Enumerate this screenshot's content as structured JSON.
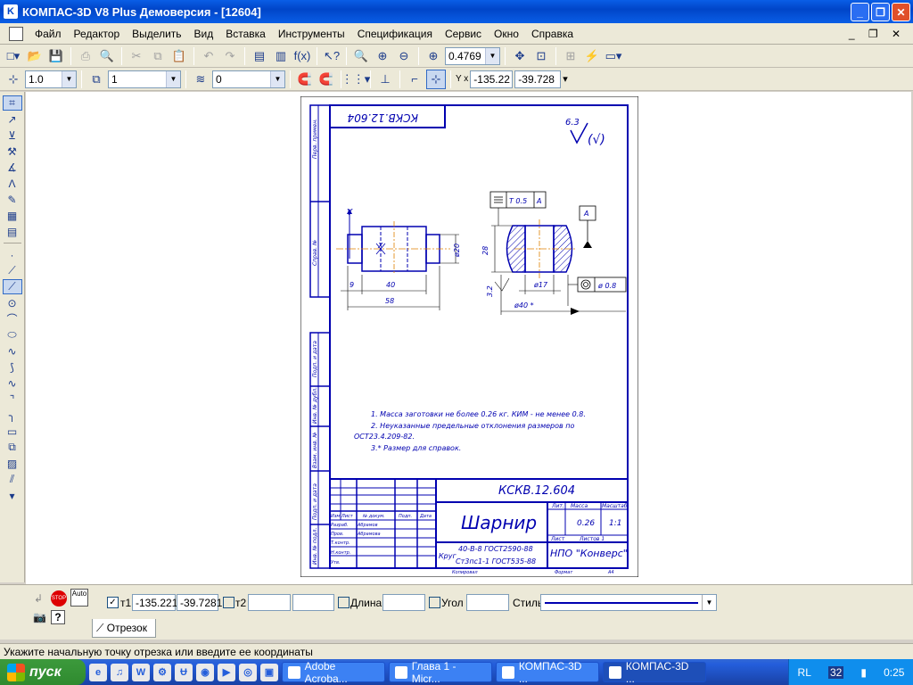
{
  "window": {
    "title": "КОМПАС-3D V8 Plus Демоверсия - [12604]"
  },
  "menu": [
    "Файл",
    "Редактор",
    "Выделить",
    "Вид",
    "Вставка",
    "Инструменты",
    "Спецификация",
    "Сервис",
    "Окно",
    "Справка"
  ],
  "toolbar1": {
    "zoom_value": "0.4769"
  },
  "toolbar2": {
    "step": "1.0",
    "layer": "1",
    "style_value": "0",
    "coord_x": "-135.22",
    "coord_y": "-39.728",
    "yx_label": "Y x"
  },
  "drawing": {
    "code_rotated": "КСКВ.12.604",
    "roughness": "6.3",
    "roughness_paren": "(√)",
    "axis_y": "Y",
    "axis_x": "X",
    "dim_9": "9",
    "dim_40": "40",
    "dim_58": "58",
    "dim_d20": "ø20",
    "dim_28": "28",
    "dim_d17": "ø17",
    "dim_d40": "ø40 *",
    "dim_32": "3.2",
    "tol_flat": "T 0.5",
    "tol_flat_ref": "A",
    "tol_conc": "ø 0.8",
    "datum": "A",
    "notes": [
      "1. Масса заготовки не более 0.26 кг. КИМ - не менее 0.8.",
      "2. Неуказанные предельные отклонения размеров по",
      "ОСТ23.4.209-82.",
      "3.* Размер для справок."
    ],
    "title_block": {
      "code": "КСКВ.12.604",
      "name": "Шарнир",
      "material_1": "40-В-8 ГОСТ2590-88",
      "material_label": "Круг",
      "material_2": "Ст3пс1-1 ГОСТ535-88",
      "lit": "Лит.",
      "mass_label": "Масса",
      "scale_label": "Масштаб",
      "mass": "0.26",
      "scale": "1:1",
      "sheet": "Лист",
      "sheets": "Листов  1",
      "org": "НПО \"Конверс\"",
      "copied": "Копировал",
      "format": "Формат",
      "format_val": "А4",
      "rows": [
        "Изм",
        "Лист",
        "№ докум.",
        "Подп.",
        "Дата"
      ],
      "roles": [
        "Разраб.",
        "Пров.",
        "Т.контр.",
        "Н.контр.",
        "Утв."
      ],
      "names": [
        "Абрамов",
        "Абрамова"
      ]
    },
    "side_labels": [
      "Перв. примен.",
      "Справ. №",
      "Подп. и дата",
      "Инв. № дубл.",
      "Взам. инв. №",
      "Подп. и дата",
      "Инв. № подл."
    ]
  },
  "propbar": {
    "t1_label": "т1",
    "t1_x": "-135.221",
    "t1_y": "-39.7281",
    "t2_label": "т2",
    "length_label": "Длина",
    "angle_label": "Угол",
    "style_label": "Стиль",
    "auto_label": "Auto",
    "stop_label": "STOP"
  },
  "tab": {
    "label": "Отрезок"
  },
  "status": {
    "text": "Укажите начальную точку отрезка или введите ее координаты"
  },
  "taskbar": {
    "start": "пуск",
    "tasks": [
      "Adobe Acroba...",
      "Глава 1 - Micr...",
      "КОМПАС-3D ...",
      "КОМПАС-3D ..."
    ],
    "lang": "RL",
    "tray_num": "32",
    "time": "0:25",
    "ql_icons": [
      "ie-icon",
      "media-icon",
      "word-icon",
      "tool-icon",
      "w-icon",
      "opera-icon",
      "player-icon",
      "cd-icon",
      "ql-icon"
    ]
  }
}
